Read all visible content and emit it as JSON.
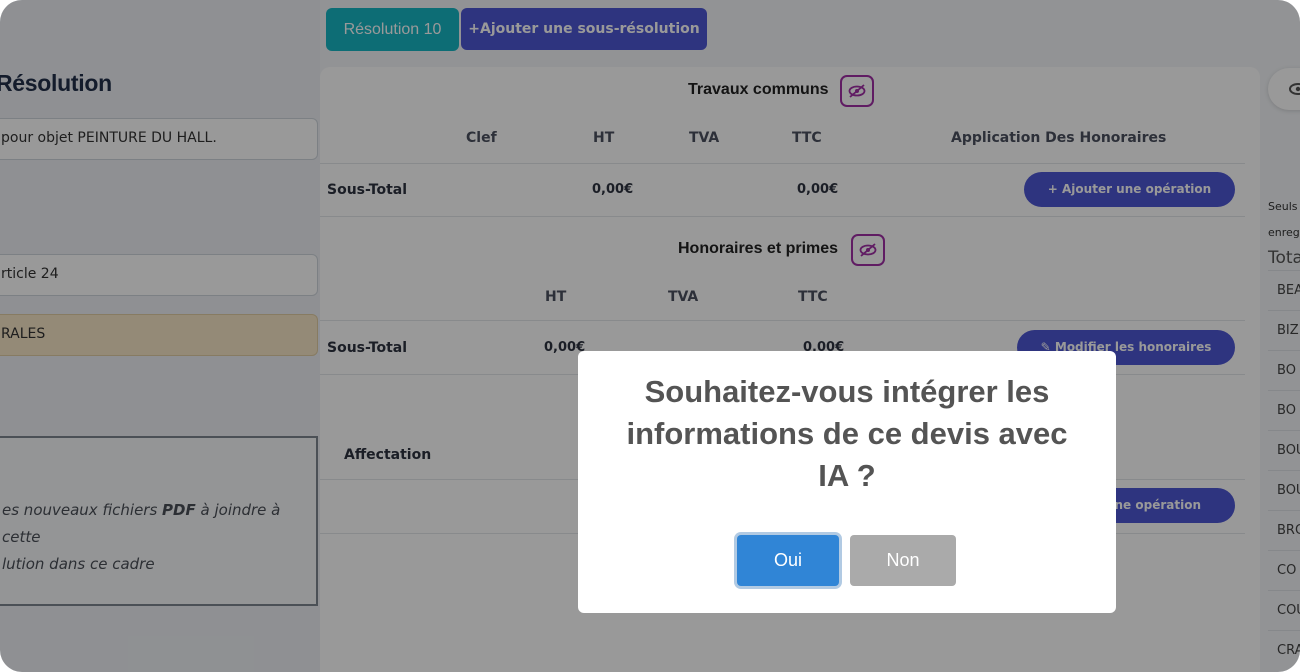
{
  "left": {
    "heading": "Résolution",
    "object_field": "pour objet PEINTURE DU HALL.",
    "article_field": "rticle 24",
    "category_field": "RALES",
    "dropzone_part1": "es nouveaux fichiers ",
    "dropzone_bold": "PDF",
    "dropzone_part2": " à joindre à cette",
    "dropzone_line2": "lution dans ce cadre"
  },
  "tabs": {
    "resolution": "Résolution 10",
    "add_sub": "+Ajouter une sous-résolution"
  },
  "travaux": {
    "title": "Travaux communs",
    "columns": [
      "Clef",
      "HT",
      "TVA",
      "TTC",
      "Application Des Honoraires"
    ],
    "subtotal_label": "Sous-Total",
    "subtotal_ht": "0,00€",
    "subtotal_ttc": "0,00€",
    "add_operation": "+ Ajouter une opération"
  },
  "honoraires": {
    "title": "Honoraires et primes",
    "columns": [
      "HT",
      "TVA",
      "TTC"
    ],
    "subtotal_label": "Sous-Total",
    "subtotal_ht": "0,00€",
    "subtotal_ttc": "0,00€",
    "modify_button": "Modifier les honoraires"
  },
  "affectation": {
    "label": "Affectation",
    "add_operation": "une opération"
  },
  "right_panel": {
    "note_line1": "Seuls",
    "note_line2": "enreg",
    "total_label": "Tota",
    "items": [
      "BEA",
      "BIZ",
      "BO",
      "BO",
      "BOU",
      "BOU",
      "BRO",
      "CO",
      "COU",
      "CRA"
    ]
  },
  "modal": {
    "title": "Souhaitez-vous intégrer les informations de ce devis avec IA ?",
    "confirm": "Oui",
    "cancel": "Non"
  },
  "colors": {
    "primary": "#4e57d4",
    "teal": "#17b6c4",
    "confirm": "#3085d6",
    "cancel": "#aaaaaa",
    "icon_accent": "#a02fa6"
  },
  "icons": {
    "eye_toggle": "eye-slash-icon",
    "pencil": "pencil-icon"
  }
}
